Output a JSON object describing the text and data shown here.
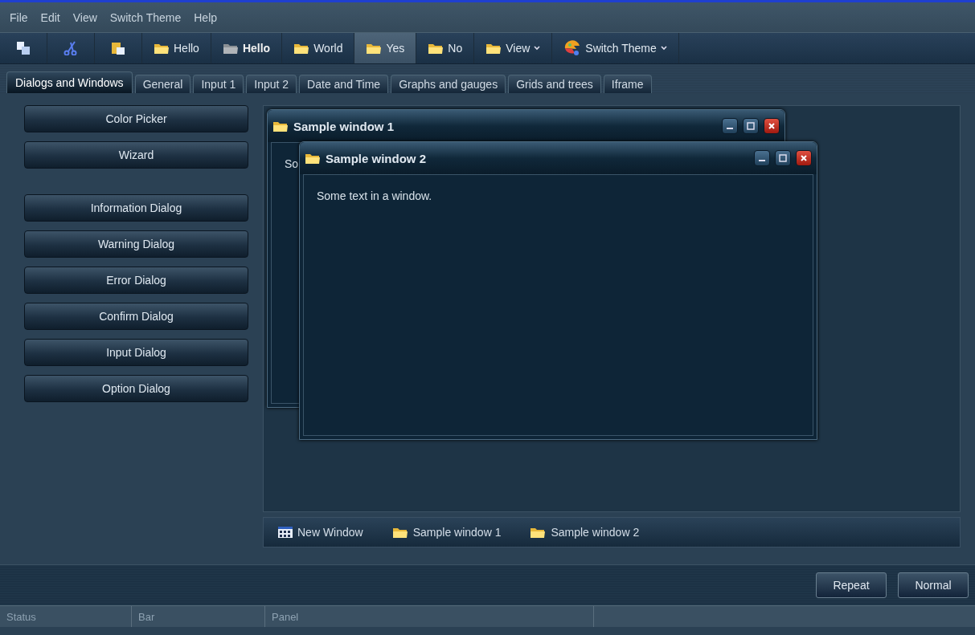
{
  "menu": [
    "File",
    "Edit",
    "View",
    "Switch Theme",
    "Help"
  ],
  "toolbar": [
    {
      "kind": "icon"
    },
    {
      "kind": "icon"
    },
    {
      "kind": "icon"
    },
    {
      "kind": "button",
      "label": "Hello",
      "selected": false,
      "disabled": false
    },
    {
      "kind": "button",
      "label": "Hello",
      "selected": false,
      "disabled": true
    },
    {
      "kind": "button",
      "label": "World",
      "selected": false,
      "disabled": false
    },
    {
      "kind": "button",
      "label": "Yes",
      "selected": true,
      "disabled": false
    },
    {
      "kind": "button",
      "label": "No",
      "selected": false,
      "disabled": false
    },
    {
      "kind": "menu",
      "label": "View",
      "selected": false,
      "disabled": false
    },
    {
      "kind": "theme",
      "label": "Switch Theme",
      "selected": false,
      "disabled": false
    }
  ],
  "tabs": [
    {
      "label": "Dialogs and Windows",
      "selected": true
    },
    {
      "label": "General",
      "selected": false
    },
    {
      "label": "Input 1",
      "selected": false
    },
    {
      "label": "Input 2",
      "selected": false
    },
    {
      "label": "Date and Time",
      "selected": false
    },
    {
      "label": "Graphs and gauges",
      "selected": false
    },
    {
      "label": "Grids and trees",
      "selected": false
    },
    {
      "label": "Iframe",
      "selected": false
    }
  ],
  "button_groups": [
    [
      "Color Picker",
      "Wizard"
    ],
    [
      "Information Dialog",
      "Warning Dialog",
      "Error Dialog",
      "Confirm Dialog",
      "Input Dialog",
      "Option Dialog"
    ]
  ],
  "windows": [
    {
      "title": "Sample window 1",
      "text": "So"
    },
    {
      "title": "Sample window 2",
      "text": "Some text in a window."
    }
  ],
  "taskbar": [
    {
      "kind": "launcher",
      "label": "New Window"
    },
    {
      "kind": "window",
      "label": "Sample window 1"
    },
    {
      "kind": "window",
      "label": "Sample window 2"
    }
  ],
  "footer_buttons": [
    "Repeat",
    "Normal"
  ],
  "status_bar": [
    "Status",
    "Bar",
    "Panel"
  ]
}
